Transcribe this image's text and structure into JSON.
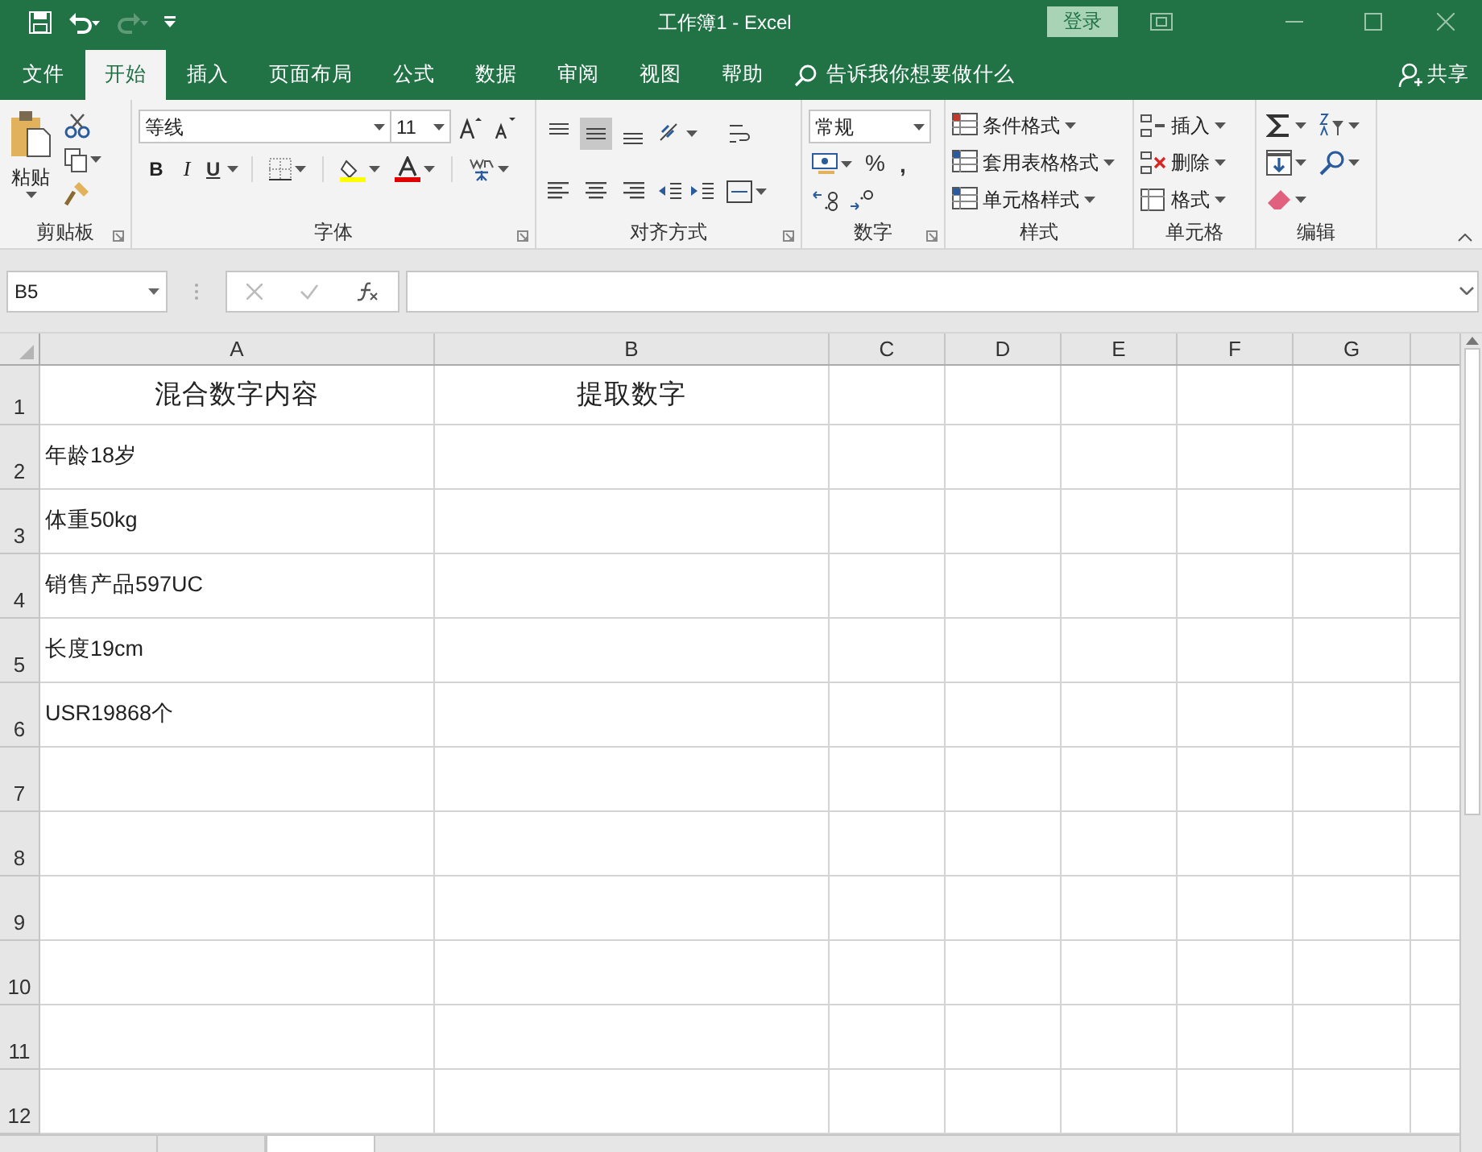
{
  "window": {
    "title": "工作簿1  -  Excel",
    "sign_in": "登录"
  },
  "menu_tabs": [
    {
      "label": "文件",
      "selected": false
    },
    {
      "label": "开始",
      "selected": true
    },
    {
      "label": "插入",
      "selected": false
    },
    {
      "label": "页面布局",
      "selected": false
    },
    {
      "label": "公式",
      "selected": false
    },
    {
      "label": "数据",
      "selected": false
    },
    {
      "label": "审阅",
      "selected": false
    },
    {
      "label": "视图",
      "selected": false
    },
    {
      "label": "帮助",
      "selected": false
    }
  ],
  "tell_me": {
    "placeholder": "告诉我你想要做什么"
  },
  "share": "共享",
  "ribbon": {
    "groups": [
      {
        "kind": "clipboard",
        "label": "剪贴板",
        "paste": "粘贴"
      },
      {
        "kind": "font",
        "label": "字体",
        "font_name": "等线",
        "font_size": "11",
        "bold": "B",
        "italic": "I",
        "underline": "U"
      },
      {
        "kind": "alignment",
        "label": "对齐方式"
      },
      {
        "kind": "number",
        "label": "数字",
        "format": "常规",
        "percent": "%",
        "comma": ","
      },
      {
        "kind": "styles",
        "label": "样式",
        "buttons": [
          "条件格式",
          "套用表格格式",
          "单元格样式"
        ]
      },
      {
        "kind": "cells",
        "label": "单元格",
        "buttons": [
          "插入",
          "删除",
          "格式"
        ]
      },
      {
        "kind": "editing",
        "label": "编辑"
      }
    ]
  },
  "name_box": "B5",
  "columns": [
    "A",
    "B",
    "C",
    "D",
    "E",
    "F",
    "G"
  ],
  "rows": [
    {
      "number": "1",
      "cells": [
        "混合数字内容",
        "提取数字"
      ],
      "kind": "heading"
    },
    {
      "number": "2",
      "cells": [
        "年龄18岁"
      ],
      "kind": "plain"
    },
    {
      "number": "3",
      "cells": [
        "体重50kg"
      ],
      "kind": "plain"
    },
    {
      "number": "4",
      "cells": [
        "销售产品597UC"
      ],
      "kind": "plain"
    },
    {
      "number": "5",
      "cells": [
        "长度19cm"
      ],
      "kind": "plain"
    },
    {
      "number": "6",
      "cells": [
        "USR19868个"
      ],
      "kind": "plain"
    },
    {
      "number": "7",
      "kind": "plain"
    },
    {
      "number": "8",
      "kind": "plain"
    },
    {
      "number": "9",
      "kind": "plain"
    },
    {
      "number": "10",
      "kind": "plain"
    },
    {
      "number": "11",
      "kind": "plain"
    },
    {
      "number": "12",
      "kind": "plain"
    }
  ],
  "sheet_tabs": [
    {
      "selected": false
    },
    {
      "selected": true
    }
  ]
}
